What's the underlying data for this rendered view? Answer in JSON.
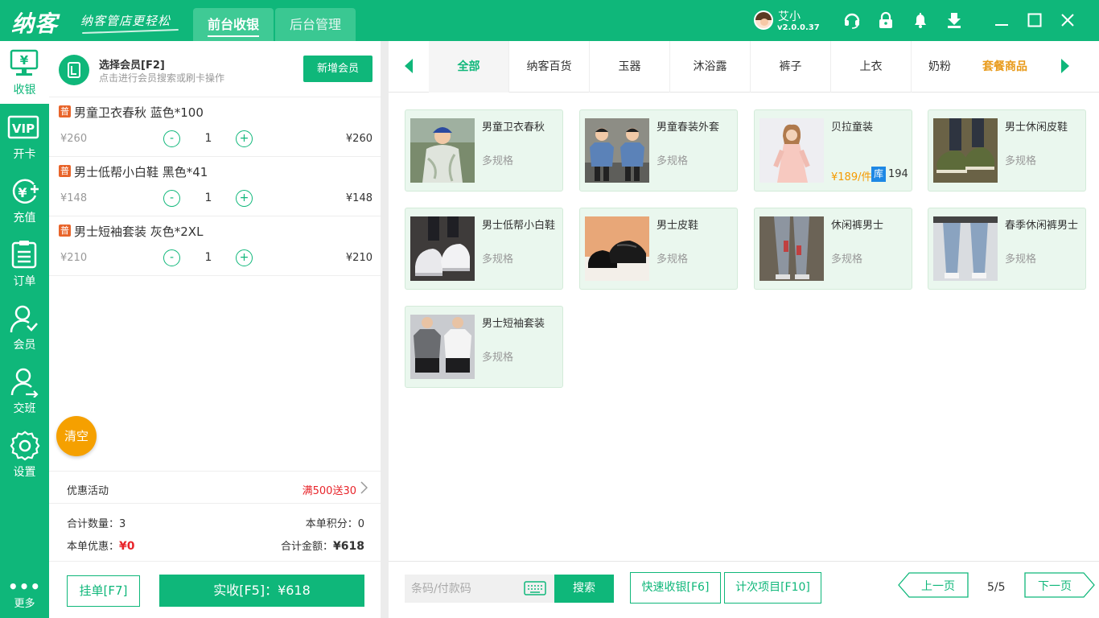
{
  "topbar": {
    "logo": "纳客",
    "slogan": "纳客管店更轻松",
    "tabs": [
      {
        "label": "前台收银",
        "active": true
      },
      {
        "label": "后台管理",
        "active": false
      }
    ],
    "user": {
      "name": "艾小",
      "version": "v2.0.0.37"
    },
    "icons": [
      "headset-icon",
      "lock-icon",
      "bell-icon",
      "download-icon",
      "minimize-icon",
      "maximize-icon",
      "close-icon"
    ]
  },
  "leftnav": {
    "items": [
      {
        "label": "收银",
        "icon": "cashier-icon",
        "active": true
      },
      {
        "label": "开卡",
        "icon": "vip-card-icon",
        "active": false
      },
      {
        "label": "充值",
        "icon": "recharge-icon",
        "active": false
      },
      {
        "label": "订单",
        "icon": "order-icon",
        "active": false
      },
      {
        "label": "会员",
        "icon": "member-icon",
        "active": false
      },
      {
        "label": "交班",
        "icon": "shift-icon",
        "active": false
      },
      {
        "label": "设置",
        "icon": "settings-icon",
        "active": false
      }
    ],
    "more_label": "更多"
  },
  "member": {
    "title": "选择会员[F2]",
    "subtitle": "点击进行会员搜索或刷卡操作",
    "add_label": "新增会员"
  },
  "cart": {
    "tag": "普",
    "items": [
      {
        "name": "男童卫衣春秋 蓝色*100",
        "price": "¥260",
        "qty": "1",
        "total": "¥260"
      },
      {
        "name": "男士低帮小白鞋 黑色*41",
        "price": "¥148",
        "qty": "1",
        "total": "¥148"
      },
      {
        "name": "男士短袖套装 灰色*2XL",
        "price": "¥210",
        "qty": "1",
        "total": "¥210"
      }
    ],
    "minus": "-",
    "plus": "+",
    "clear_label": "清空",
    "promo_label": "优惠活动",
    "promo_value": "满500送30",
    "summary": {
      "count_label": "合计数量：",
      "count_value": "3",
      "points_label": "本单积分：",
      "points_value": "0",
      "discount_label": "本单优惠：",
      "discount_value": "¥0",
      "total_label": "合计金额：",
      "total_value": "¥618"
    },
    "hold_label": "挂单[F7]",
    "pay_label": "实收[F5]：¥618"
  },
  "categories": {
    "items": [
      "全部",
      "纳客百货",
      "玉器",
      "沐浴露",
      "裤子",
      "上衣",
      "奶粉"
    ],
    "active_index": 0,
    "combo": "套餐商品"
  },
  "products": [
    {
      "name": "男童卫衣春秋",
      "spec": "多规格",
      "price": "",
      "stock": ""
    },
    {
      "name": "男童春装外套",
      "spec": "多规格",
      "price": "",
      "stock": ""
    },
    {
      "name": "贝拉童装",
      "spec": "",
      "price": "¥189/件",
      "stock_badge": "库",
      "stock": "194"
    },
    {
      "name": "男士休闲皮鞋",
      "spec": "多规格",
      "price": "",
      "stock": ""
    },
    {
      "name": "男士低帮小白鞋",
      "spec": "多规格",
      "price": "",
      "stock": ""
    },
    {
      "name": "男士皮鞋",
      "spec": "多规格",
      "price": "",
      "stock": ""
    },
    {
      "name": "休闲裤男士",
      "spec": "多规格",
      "price": "",
      "stock": ""
    },
    {
      "name": "春季休闲裤男士",
      "spec": "多规格",
      "price": "",
      "stock": ""
    },
    {
      "name": "男士短袖套装",
      "spec": "多规格",
      "price": "",
      "stock": ""
    }
  ],
  "footer": {
    "search_placeholder": "条码/付款码",
    "search_label": "搜索",
    "quick_label": "快速收银[F6]",
    "count_item_label": "计次项目[F10]",
    "prev_label": "上一页",
    "next_label": "下一页",
    "page": "5/5"
  },
  "colors": {
    "brand": "#0fb77a",
    "accent": "#f5a000",
    "danger": "#e8242a",
    "info": "#1e88e5"
  }
}
